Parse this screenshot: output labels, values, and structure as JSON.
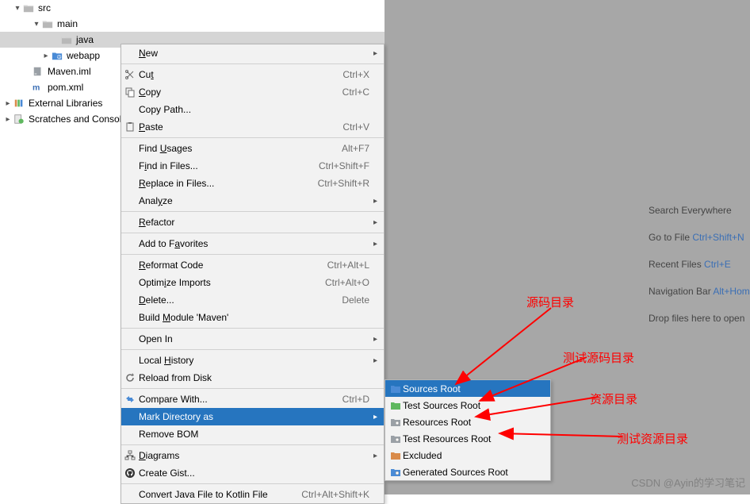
{
  "tree": {
    "items": [
      {
        "indent": 16,
        "chev": "down",
        "icon": "folder",
        "label": "src"
      },
      {
        "indent": 40,
        "chev": "down",
        "icon": "folder",
        "label": "main"
      },
      {
        "indent": 64,
        "chev": "",
        "icon": "folder",
        "label": "java",
        "selected": true
      },
      {
        "indent": 52,
        "chev": "right",
        "icon": "webfolder",
        "label": "webapp"
      },
      {
        "indent": 28,
        "chev": "",
        "icon": "idea",
        "label": "Maven.iml"
      },
      {
        "indent": 28,
        "chev": "",
        "icon": "maven",
        "label": "pom.xml"
      },
      {
        "indent": 4,
        "chev": "right",
        "icon": "lib",
        "label": "External Libraries"
      },
      {
        "indent": 4,
        "chev": "right",
        "icon": "scratch",
        "label": "Scratches and Consoles"
      }
    ]
  },
  "menu": [
    {
      "label": "New",
      "mn": 0,
      "sub": true
    },
    {
      "sep": true
    },
    {
      "icon": "cut",
      "label": "Cut",
      "mn": 2,
      "sc": "Ctrl+X"
    },
    {
      "icon": "copy",
      "label": "Copy",
      "mn": 0,
      "sc": "Ctrl+C"
    },
    {
      "label": "Copy Path...",
      "mn": -1
    },
    {
      "icon": "paste",
      "label": "Paste",
      "mn": 0,
      "sc": "Ctrl+V"
    },
    {
      "sep": true
    },
    {
      "label": "Find Usages",
      "mn": 5,
      "sc": "Alt+F7"
    },
    {
      "label": "Find in Files...",
      "mn": 1,
      "sc": "Ctrl+Shift+F"
    },
    {
      "label": "Replace in Files...",
      "mn": 0,
      "sc": "Ctrl+Shift+R"
    },
    {
      "label": "Analyze",
      "mn": 4,
      "sub": true
    },
    {
      "sep": true
    },
    {
      "label": "Refactor",
      "mn": 0,
      "sub": true
    },
    {
      "sep": true
    },
    {
      "label": "Add to Favorites",
      "mn": 8,
      "sub": true
    },
    {
      "sep": true
    },
    {
      "label": "Reformat Code",
      "mn": 0,
      "sc": "Ctrl+Alt+L"
    },
    {
      "label": "Optimize Imports",
      "mn": 5,
      "sc": "Ctrl+Alt+O"
    },
    {
      "label": "Delete...",
      "mn": 0,
      "sc": "Delete"
    },
    {
      "label": "Build Module 'Maven'",
      "mn": 6
    },
    {
      "sep": true
    },
    {
      "label": "Open In",
      "mn": -1,
      "sub": true
    },
    {
      "sep": true
    },
    {
      "label": "Local History",
      "mn": 6,
      "sub": true
    },
    {
      "icon": "reload",
      "label": "Reload from Disk",
      "mn": -1
    },
    {
      "sep": true
    },
    {
      "icon": "compare",
      "label": "Compare With...",
      "mn": -1,
      "sc": "Ctrl+D"
    },
    {
      "label": "Mark Directory as",
      "mn": -1,
      "sub": true,
      "hl": true
    },
    {
      "label": "Remove BOM",
      "mn": -1
    },
    {
      "sep": true
    },
    {
      "icon": "diagram",
      "label": "Diagrams",
      "mn": 0,
      "sub": true
    },
    {
      "icon": "github",
      "label": "Create Gist...",
      "mn": -1
    },
    {
      "sep": true
    },
    {
      "label": "Convert Java File to Kotlin File",
      "mn": -1,
      "sc": "Ctrl+Alt+Shift+K"
    }
  ],
  "submenu": [
    {
      "color": "#4a8bd6",
      "label": "Sources Root",
      "hl": true
    },
    {
      "color": "#5fb85f",
      "label": "Test Sources Root"
    },
    {
      "color": "#9aa0a6",
      "label": "Resources Root",
      "dot": true
    },
    {
      "color": "#9aa0a6",
      "label": "Test Resources Root",
      "dot": true
    },
    {
      "color": "#d98b4a",
      "label": "Excluded"
    },
    {
      "color": "#4a8bd6",
      "label": "Generated Sources Root",
      "dot": true
    }
  ],
  "tips": [
    {
      "t": "Search Everywhere",
      "sc": ""
    },
    {
      "t": "Go to File ",
      "sc": "Ctrl+Shift+N"
    },
    {
      "t": "Recent Files ",
      "sc": "Ctrl+E"
    },
    {
      "t": "Navigation Bar ",
      "sc": "Alt+Home"
    },
    {
      "t": "Drop files here to open",
      "sc": ""
    }
  ],
  "annotations": {
    "a1": "源码目录",
    "a2": "测试源码目录",
    "a3": "资源目录",
    "a4": "测试资源目录"
  },
  "watermark": "CSDN @Ayin的学习笔记"
}
